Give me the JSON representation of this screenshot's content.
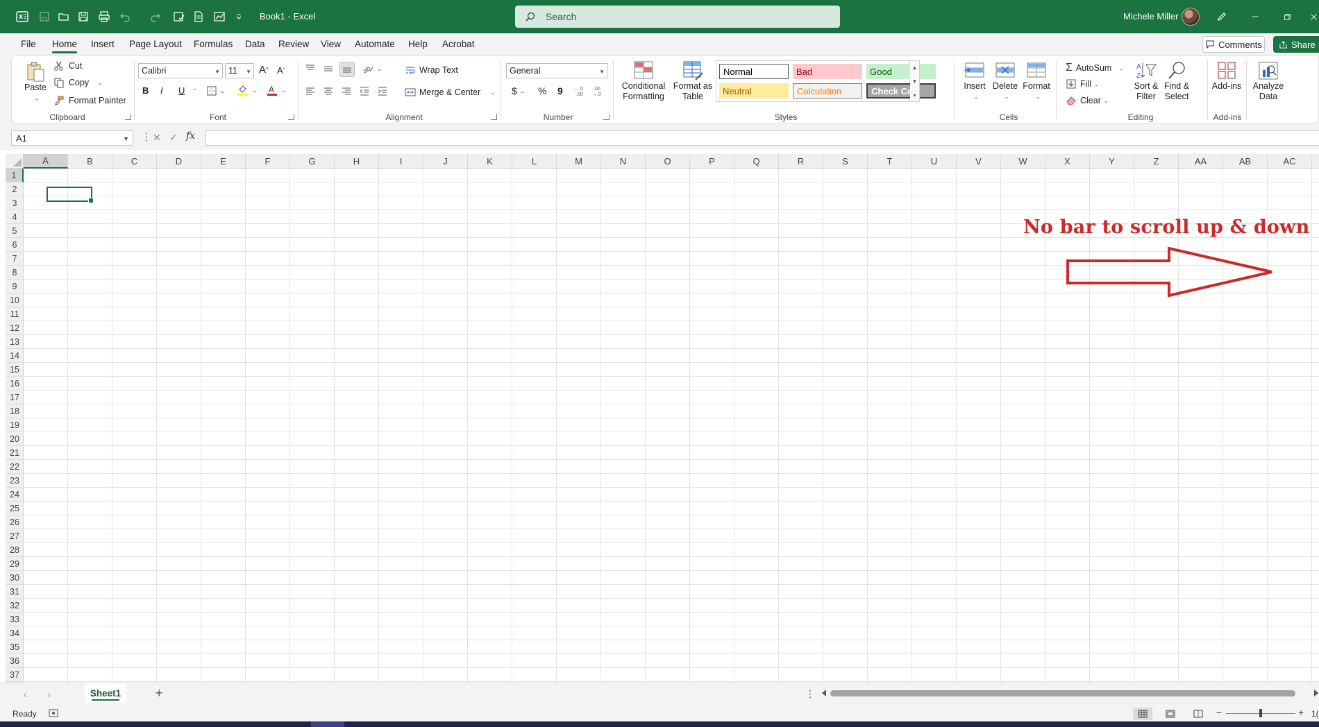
{
  "app": {
    "doc_title": "Book1  -  Excel",
    "search_placeholder": "Search",
    "user_name": "Michele Miller",
    "quick_access_icons": [
      "excel-logo-icon",
      "autosave-icon",
      "open-folder-icon",
      "save-icon",
      "print-preview-icon",
      "undo-icon",
      "redo-icon",
      "spelling-icon",
      "form-icon",
      "chart-icon",
      "customize-qat-icon"
    ],
    "window_controls": [
      "pen-icon",
      "minimize-icon",
      "restore-icon",
      "close-icon"
    ]
  },
  "menu": {
    "tabs": [
      "File",
      "Home",
      "Insert",
      "Page Layout",
      "Formulas",
      "Data",
      "Review",
      "View",
      "Automate",
      "Help",
      "Acrobat"
    ],
    "active_tab": "Home",
    "comments_label": "Comments",
    "share_label": "Share"
  },
  "ribbon": {
    "clipboard": {
      "paste": "Paste",
      "cut": "Cut",
      "copy": "Copy",
      "format_painter": "Format Painter",
      "label": "Clipboard"
    },
    "font": {
      "font_name": "Calibri",
      "font_size": "11",
      "bold": "B",
      "italic": "I",
      "underline": "U",
      "label": "Font"
    },
    "alignment": {
      "wrap_text": "Wrap Text",
      "merge_center": "Merge & Center",
      "label": "Alignment"
    },
    "number": {
      "format": "General",
      "currency": "$",
      "percent": "%",
      "comma": "9",
      "label": "Number"
    },
    "styles": {
      "conditional_formatting_1": "Conditional",
      "conditional_formatting_2": "Formatting",
      "format_as_table_1": "Format as",
      "format_as_table_2": "Table",
      "gallery": [
        {
          "name": "Normal",
          "bg": "#ffffff",
          "fg": "#000000"
        },
        {
          "name": "Bad",
          "bg": "#ffc7ce",
          "fg": "#9c0006"
        },
        {
          "name": "Good",
          "bg": "#c6efce",
          "fg": "#006100"
        },
        {
          "name": "Neutral",
          "bg": "#ffeb9c",
          "fg": "#9c5700"
        },
        {
          "name": "Calculation",
          "bg": "#f2f2f2",
          "fg": "#fa7d00"
        },
        {
          "name": "Check Cell",
          "bg": "#a5a5a5",
          "fg": "#ffffff"
        }
      ],
      "label": "Styles"
    },
    "cells": {
      "insert": "Insert",
      "delete": "Delete",
      "format": "Format",
      "label": "Cells"
    },
    "editing": {
      "autosum": "AutoSum",
      "fill": "Fill",
      "clear": "Clear",
      "sort_filter_1": "Sort &",
      "sort_filter_2": "Filter",
      "find_select_1": "Find &",
      "find_select_2": "Select",
      "label": "Editing"
    },
    "addins": {
      "addins": "Add-ins",
      "label": "Add-ins",
      "analyze_1": "Analyze",
      "analyze_2": "Data"
    }
  },
  "formula_bar": {
    "name_box": "A1",
    "fx": "fx",
    "formula": ""
  },
  "grid": {
    "columns": [
      "A",
      "B",
      "C",
      "D",
      "E",
      "F",
      "G",
      "H",
      "I",
      "J",
      "K",
      "L",
      "M",
      "N",
      "O",
      "P",
      "Q",
      "R",
      "S",
      "T",
      "U",
      "V",
      "W",
      "X",
      "Y",
      "Z",
      "AA",
      "AB",
      "AC"
    ],
    "rows": [
      "1",
      "2",
      "3",
      "4",
      "5",
      "6",
      "7",
      "8",
      "9",
      "10",
      "11",
      "12",
      "13",
      "14",
      "15",
      "16",
      "17",
      "18",
      "19",
      "20",
      "21",
      "22",
      "23",
      "24",
      "25",
      "26",
      "27",
      "28",
      "29",
      "30",
      "31",
      "32",
      "33",
      "34",
      "35",
      "36",
      "37"
    ],
    "selected_cell": "A1"
  },
  "annotation": {
    "text": "No bar to scroll up & down",
    "color": "#cc2a2a"
  },
  "sheets": {
    "tabs": [
      "Sheet1"
    ],
    "active": "Sheet1"
  },
  "status": {
    "ready": "Ready",
    "zoom_partial": "1("
  },
  "colors": {
    "accent": "#1a7341"
  }
}
